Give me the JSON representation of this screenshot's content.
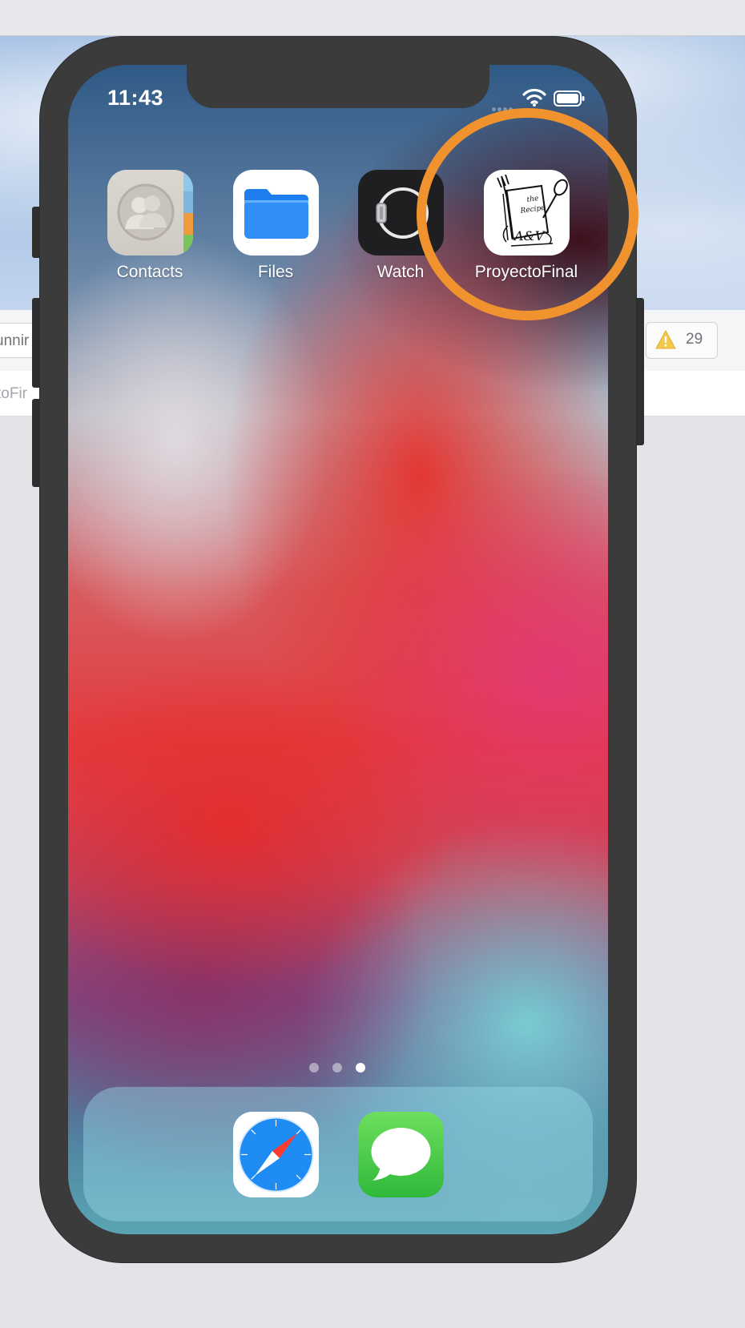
{
  "host": {
    "status_fragment": "unnir",
    "tab_fragment": "toFir",
    "warnings_count": "29",
    "warning_icon": "warning-triangle-icon"
  },
  "status_bar": {
    "time": "11:43",
    "wifi_icon": "wifi-icon",
    "battery_icon": "battery-icon"
  },
  "apps": [
    {
      "label": "Contacts",
      "icon": "contacts-icon"
    },
    {
      "label": "Files",
      "icon": "files-folder-icon"
    },
    {
      "label": "Watch",
      "icon": "watch-icon"
    },
    {
      "label": "ProyectoFinal",
      "icon": "recipe-book-icon",
      "icon_text": [
        "the",
        "Recipe",
        "A&V"
      ]
    }
  ],
  "highlight": {
    "color": "#f0922e",
    "target": "ProyectoFinal"
  },
  "page_indicator": {
    "count": 3,
    "active": 3
  },
  "dock": [
    {
      "name": "Safari",
      "icon": "safari-compass-icon"
    },
    {
      "name": "Messages",
      "icon": "messages-bubble-icon"
    }
  ]
}
